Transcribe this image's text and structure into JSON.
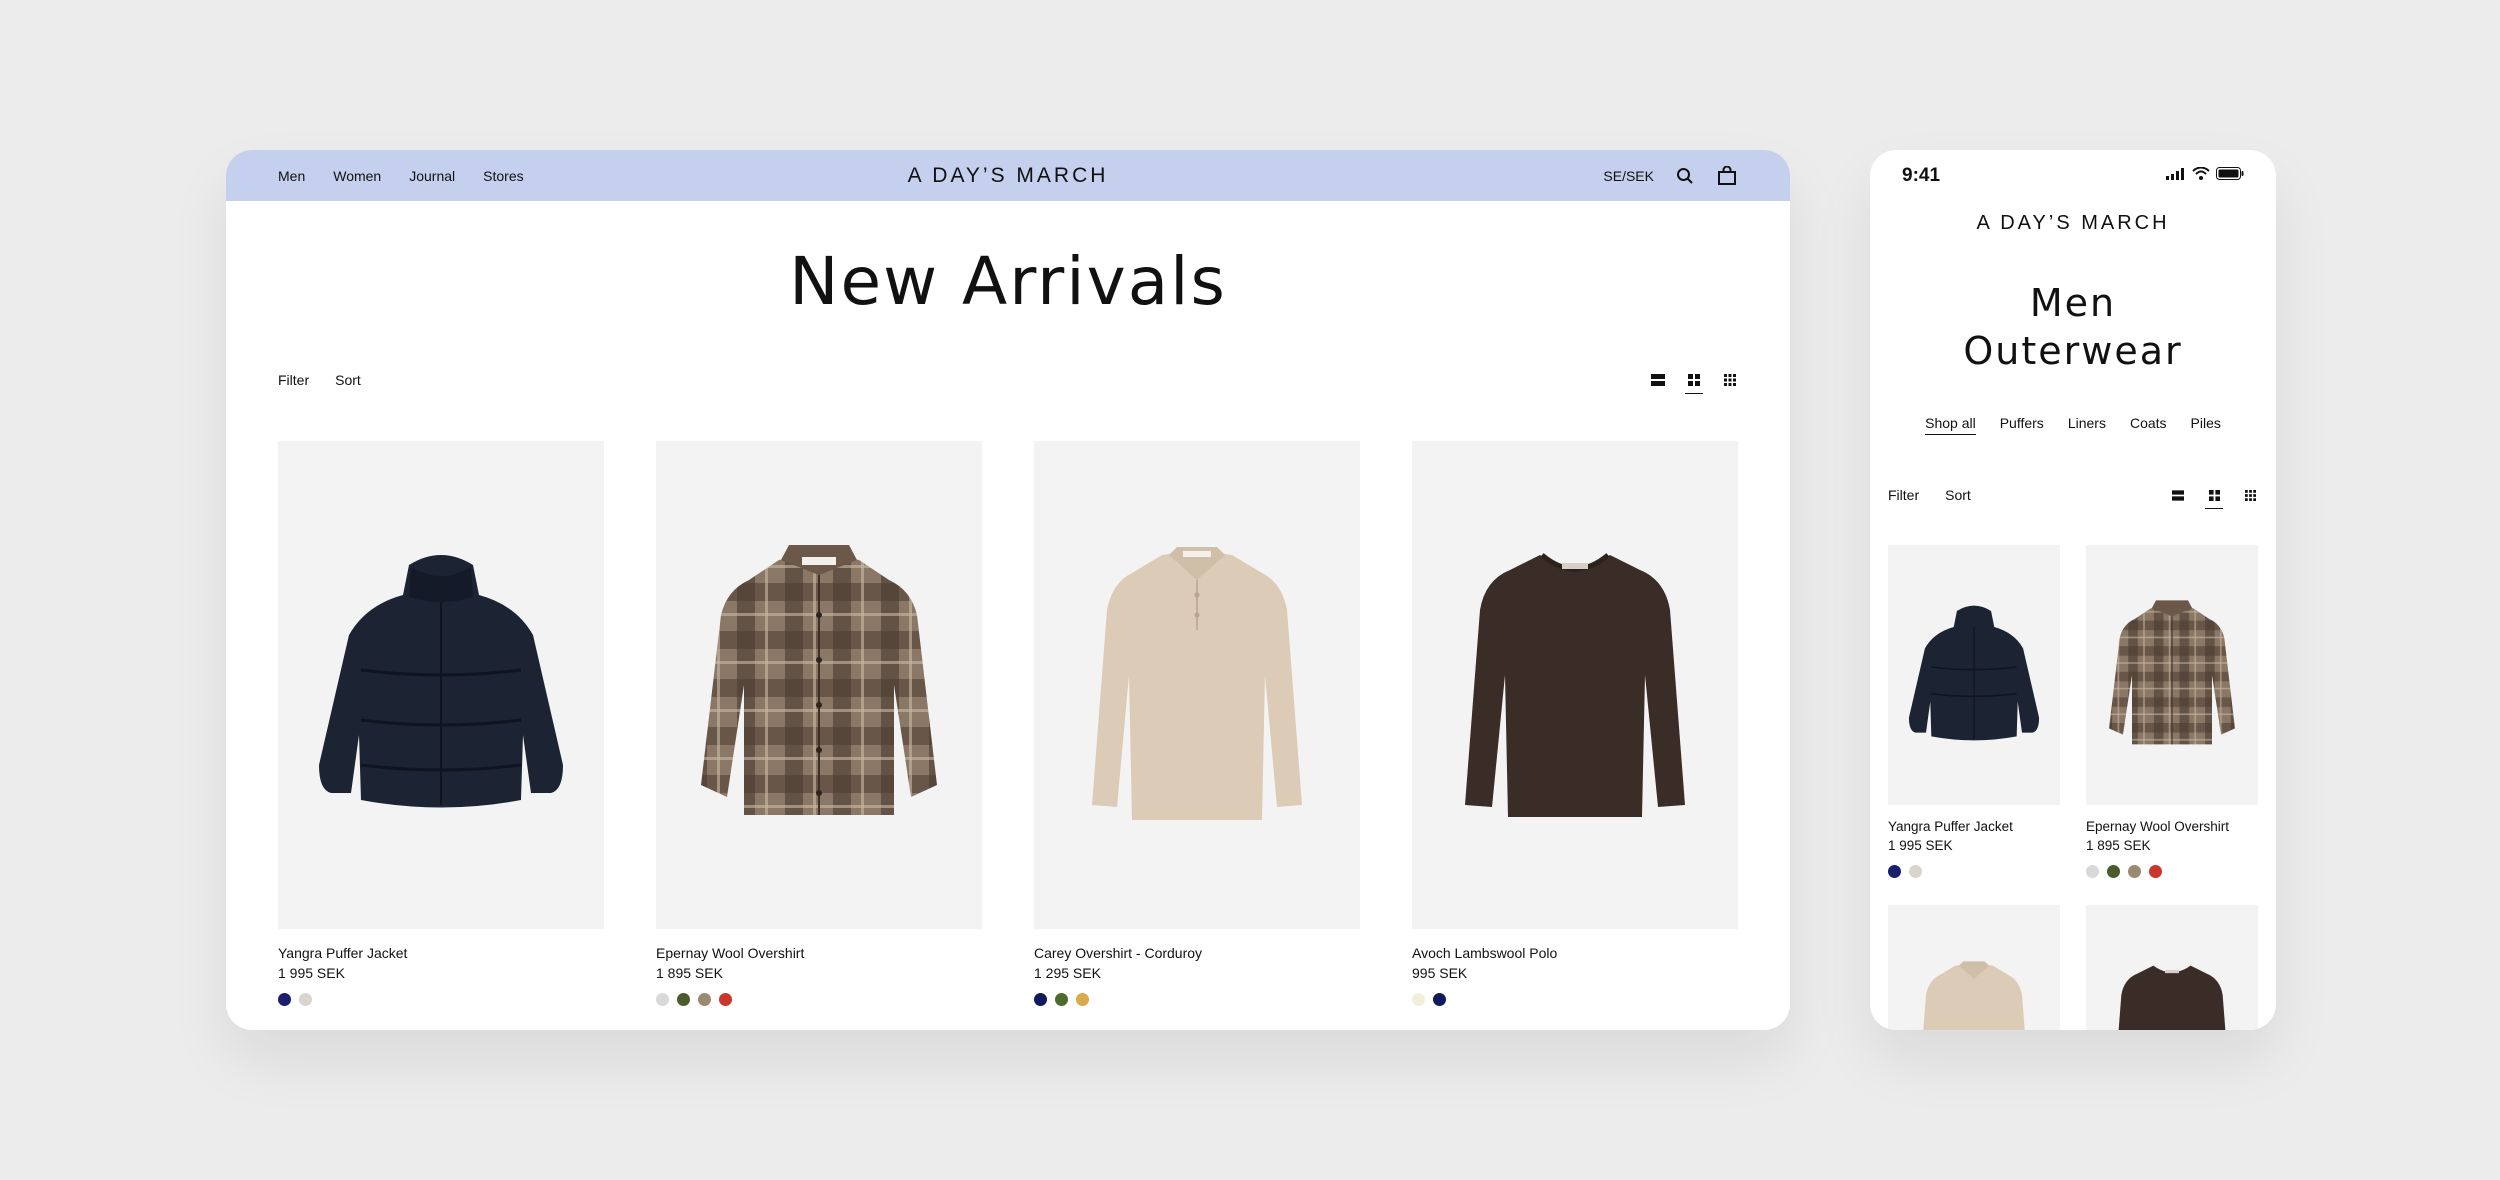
{
  "desktop": {
    "nav": {
      "links": [
        "Men",
        "Women",
        "Journal",
        "Stores"
      ],
      "logo": "A DAY’S MARCH",
      "locale": "SE/SEK"
    },
    "title": "New Arrivals",
    "toolbar": {
      "filter": "Filter",
      "sort": "Sort"
    },
    "products": [
      {
        "name": "Yangra Puffer Jacket",
        "price": "1 995 SEK",
        "swatches": [
          "#1a1f6b",
          "#d8d5cc"
        ]
      },
      {
        "name": "Epernay Wool Overshirt",
        "price": "1 895 SEK",
        "swatches": [
          "#d9d9d9",
          "#4d5a2e",
          "#9b8a72",
          "#c9372c"
        ]
      },
      {
        "name": "Carey Overshirt - Corduroy",
        "price": "1 295 SEK",
        "swatches": [
          "#121a5e",
          "#4e6a2c",
          "#d9a94a"
        ]
      },
      {
        "name": "Avoch Lambswool Polo",
        "price": "995 SEK",
        "swatches": [
          "#f1efdc",
          "#121a5e"
        ]
      }
    ]
  },
  "mobile": {
    "status": {
      "time": "9:41"
    },
    "logo": "A DAY’S MARCH",
    "title_line1": "Men",
    "title_line2": "Outerwear",
    "categories": [
      "Shop all",
      "Puffers",
      "Liners",
      "Coats",
      "Piles"
    ],
    "toolbar": {
      "filter": "Filter",
      "sort": "Sort"
    },
    "products": [
      {
        "name": "Yangra Puffer Jacket",
        "price": "1 995 SEK",
        "swatches": [
          "#1a1f6b",
          "#d8d5cc"
        ]
      },
      {
        "name": "Epernay Wool Overshirt",
        "price": "1 895 SEK",
        "swatches": [
          "#d9d9d9",
          "#4d5a2e",
          "#9b8a72",
          "#c9372c"
        ]
      }
    ]
  }
}
